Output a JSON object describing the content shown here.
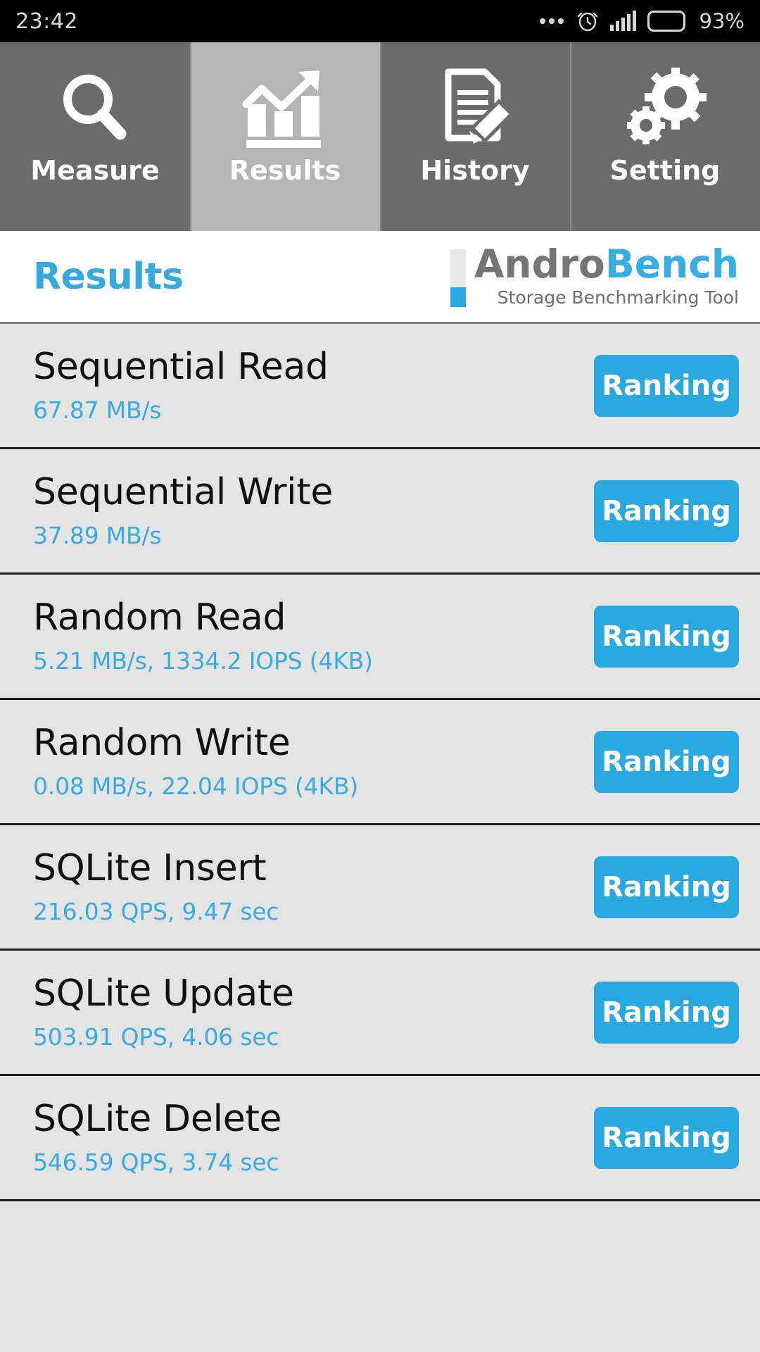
{
  "status_bar": {
    "time": "23:42",
    "battery_percent": "93%",
    "icons": [
      "more-dots-icon",
      "alarm-clock-icon",
      "signal-bars-icon",
      "battery-icon"
    ]
  },
  "tabs": [
    {
      "label": "Measure",
      "icon": "magnifier-icon",
      "active": false
    },
    {
      "label": "Results",
      "icon": "bar-chart-arrow-icon",
      "active": true
    },
    {
      "label": "History",
      "icon": "document-pencil-icon",
      "active": false
    },
    {
      "label": "Setting",
      "icon": "gears-icon",
      "active": false
    }
  ],
  "header": {
    "title": "Results",
    "brand_part1": "Andro",
    "brand_part2": "Bench",
    "brand_tagline": "Storage Benchmarking Tool"
  },
  "colors": {
    "accent_blue": "#2aa9e0",
    "title_blue": "#35a9e0",
    "value_blue": "#3aabe2",
    "tab_inactive": "#6b6b6b",
    "tab_active": "#b4b4b4",
    "row_background": "#e4e4e4",
    "brand_gray": "#757575"
  },
  "results": [
    {
      "name": "Sequential Read",
      "value": "67.87 MB/s",
      "button": "Ranking"
    },
    {
      "name": "Sequential Write",
      "value": "37.89 MB/s",
      "button": "Ranking"
    },
    {
      "name": "Random Read",
      "value": "5.21 MB/s, 1334.2 IOPS (4KB)",
      "button": "Ranking"
    },
    {
      "name": "Random Write",
      "value": "0.08 MB/s, 22.04 IOPS (4KB)",
      "button": "Ranking"
    },
    {
      "name": "SQLite Insert",
      "value": "216.03 QPS, 9.47 sec",
      "button": "Ranking"
    },
    {
      "name": "SQLite Update",
      "value": "503.91 QPS, 4.06 sec",
      "button": "Ranking"
    },
    {
      "name": "SQLite Delete",
      "value": "546.59 QPS, 3.74 sec",
      "button": "Ranking"
    }
  ]
}
